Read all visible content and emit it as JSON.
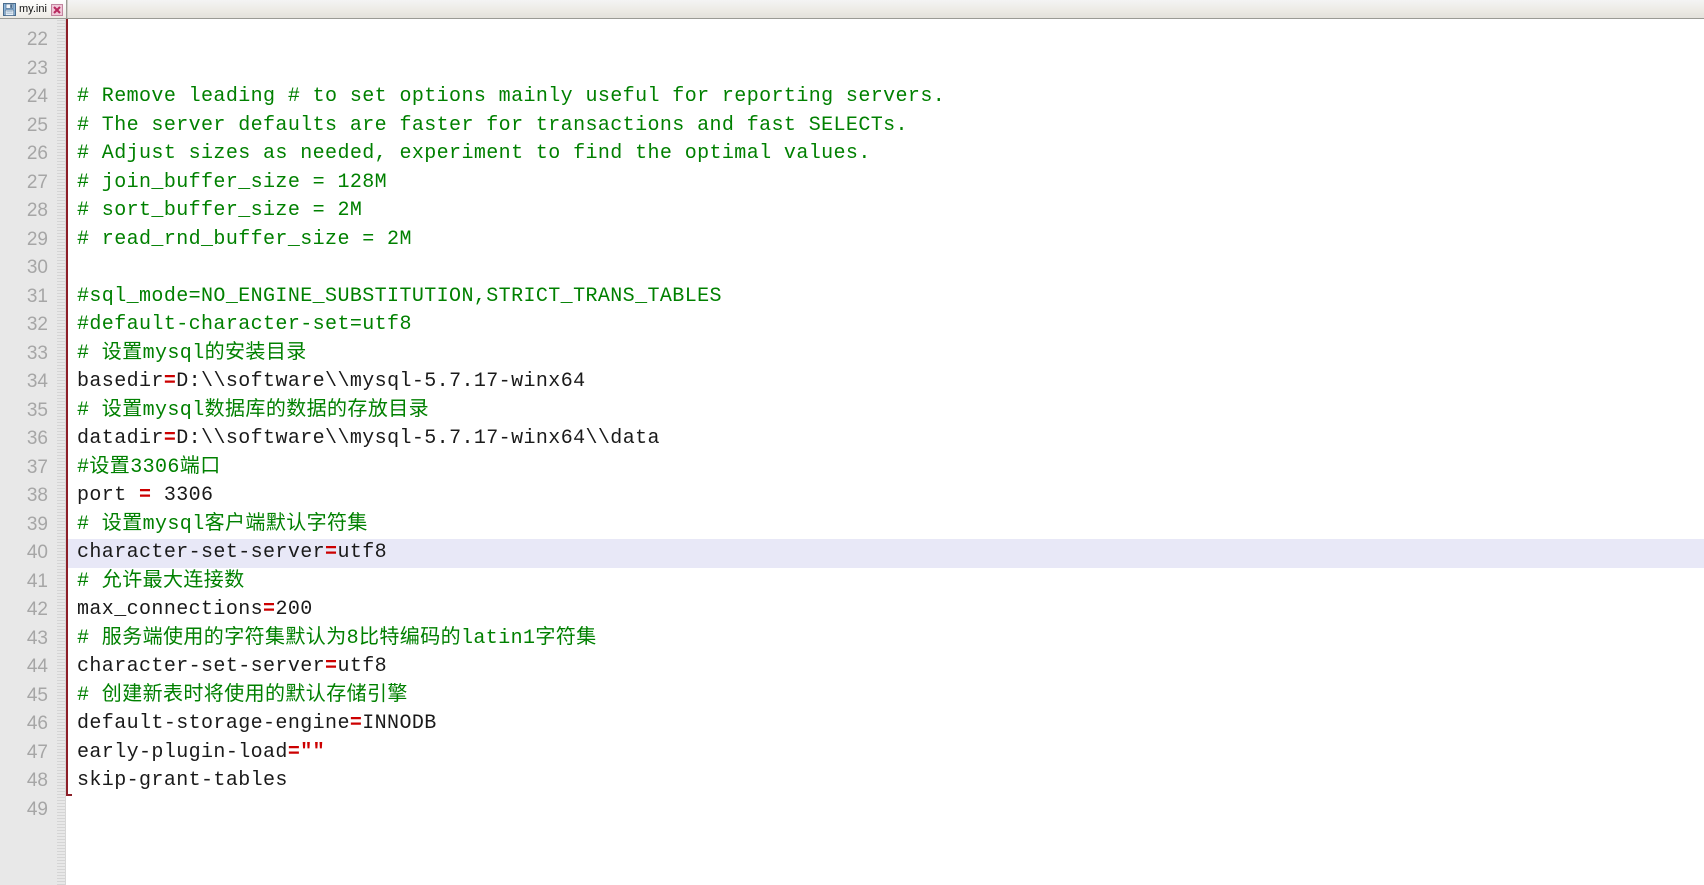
{
  "window": {
    "app_kind": "text-editor"
  },
  "tabbar": {
    "tabs": [
      {
        "label": "my.ini",
        "save_icon": "floppy-disk-save-icon",
        "close_icon": "close-x-icon",
        "active": true,
        "modified": false
      }
    ]
  },
  "editor": {
    "first_line_number": 22,
    "current_line_number": 40,
    "current_line_highlight_color": "#e8e8f7",
    "gutter_bg_color": "#e8e8e8",
    "gutter_text_color": "#a6a6a6",
    "margin_line_color": "#8c1f28",
    "comment_color": "#008000",
    "operator_color": "#cc0000",
    "text_color": "#1a1a1a",
    "background_color": "#ffffff",
    "lines": [
      {
        "n": 22,
        "tokens": []
      },
      {
        "n": 23,
        "tokens": []
      },
      {
        "n": 24,
        "tokens": [
          {
            "t": "comment",
            "s": "# Remove leading # to set options mainly useful for reporting servers."
          }
        ]
      },
      {
        "n": 25,
        "tokens": [
          {
            "t": "comment",
            "s": "# The server defaults are faster for transactions and fast SELECTs."
          }
        ]
      },
      {
        "n": 26,
        "tokens": [
          {
            "t": "comment",
            "s": "# Adjust sizes as needed, experiment to find the optimal values."
          }
        ]
      },
      {
        "n": 27,
        "tokens": [
          {
            "t": "comment",
            "s": "# join_buffer_size = 128M"
          }
        ]
      },
      {
        "n": 28,
        "tokens": [
          {
            "t": "comment",
            "s": "# sort_buffer_size = 2M"
          }
        ]
      },
      {
        "n": 29,
        "tokens": [
          {
            "t": "comment",
            "s": "# read_rnd_buffer_size = 2M"
          }
        ]
      },
      {
        "n": 30,
        "tokens": []
      },
      {
        "n": 31,
        "tokens": [
          {
            "t": "comment",
            "s": "#sql_mode=NO_ENGINE_SUBSTITUTION,STRICT_TRANS_TABLES"
          }
        ]
      },
      {
        "n": 32,
        "tokens": [
          {
            "t": "comment",
            "s": "#default-character-set=utf8"
          }
        ]
      },
      {
        "n": 33,
        "tokens": [
          {
            "t": "comment",
            "s": "# 设置mysql的安装目录"
          }
        ]
      },
      {
        "n": 34,
        "tokens": [
          {
            "t": "plain",
            "s": "basedir"
          },
          {
            "t": "op",
            "s": "="
          },
          {
            "t": "plain",
            "s": "D:\\\\software\\\\mysql-5.7.17-winx64"
          }
        ]
      },
      {
        "n": 35,
        "tokens": [
          {
            "t": "comment",
            "s": "# 设置mysql数据库的数据的存放目录"
          }
        ]
      },
      {
        "n": 36,
        "tokens": [
          {
            "t": "plain",
            "s": "datadir"
          },
          {
            "t": "op",
            "s": "="
          },
          {
            "t": "plain",
            "s": "D:\\\\software\\\\mysql-5.7.17-winx64\\\\data"
          }
        ]
      },
      {
        "n": 37,
        "tokens": [
          {
            "t": "comment",
            "s": "#设置3306端口"
          }
        ]
      },
      {
        "n": 38,
        "tokens": [
          {
            "t": "plain",
            "s": "port "
          },
          {
            "t": "op",
            "s": "="
          },
          {
            "t": "plain",
            "s": " 3306"
          }
        ]
      },
      {
        "n": 39,
        "tokens": [
          {
            "t": "comment",
            "s": "# 设置mysql客户端默认字符集"
          }
        ]
      },
      {
        "n": 40,
        "current": true,
        "tokens": [
          {
            "t": "plain",
            "s": "character-set-server"
          },
          {
            "t": "op",
            "s": "="
          },
          {
            "t": "plain",
            "s": "utf8"
          }
        ]
      },
      {
        "n": 41,
        "tokens": [
          {
            "t": "comment",
            "s": "# 允许最大连接数"
          }
        ]
      },
      {
        "n": 42,
        "tokens": [
          {
            "t": "plain",
            "s": "max_connections"
          },
          {
            "t": "op",
            "s": "="
          },
          {
            "t": "plain",
            "s": "200"
          }
        ]
      },
      {
        "n": 43,
        "tokens": [
          {
            "t": "comment",
            "s": "# 服务端使用的字符集默认为8比特编码的latin1字符集"
          }
        ]
      },
      {
        "n": 44,
        "tokens": [
          {
            "t": "plain",
            "s": "character-set-server"
          },
          {
            "t": "op",
            "s": "="
          },
          {
            "t": "plain",
            "s": "utf8"
          }
        ]
      },
      {
        "n": 45,
        "tokens": [
          {
            "t": "comment",
            "s": "# 创建新表时将使用的默认存储引擎"
          }
        ]
      },
      {
        "n": 46,
        "tokens": [
          {
            "t": "plain",
            "s": "default-storage-engine"
          },
          {
            "t": "op",
            "s": "="
          },
          {
            "t": "plain",
            "s": "INNODB"
          }
        ]
      },
      {
        "n": 47,
        "tokens": [
          {
            "t": "plain",
            "s": "early-plugin-load"
          },
          {
            "t": "op",
            "s": "="
          },
          {
            "t": "str",
            "s": "\"\""
          }
        ]
      },
      {
        "n": 48,
        "tokens": [
          {
            "t": "plain",
            "s": "skip-grant-tables"
          }
        ]
      },
      {
        "n": 49,
        "tokens": []
      }
    ]
  }
}
